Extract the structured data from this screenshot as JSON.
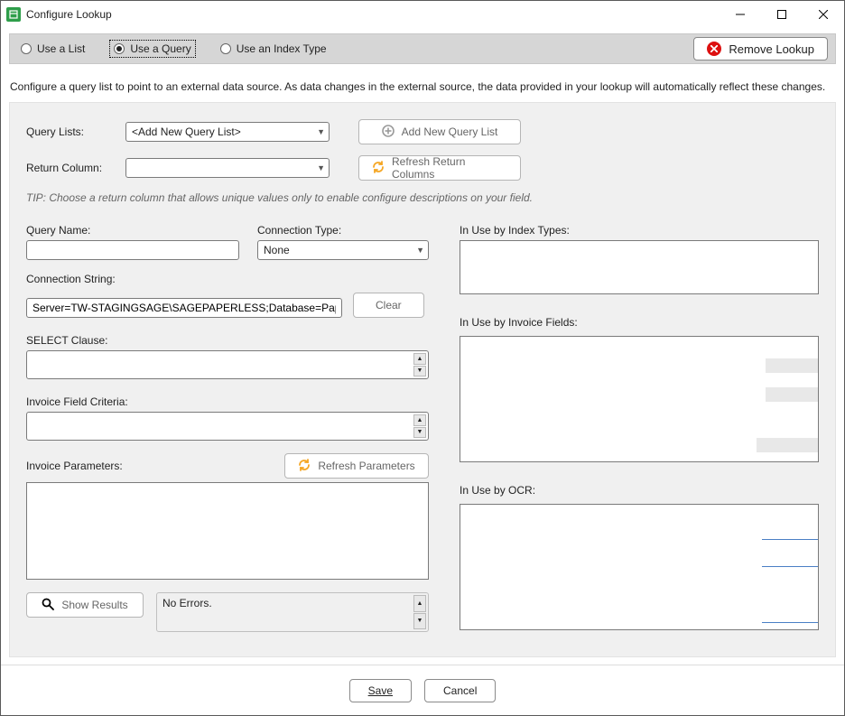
{
  "window": {
    "title": "Configure Lookup"
  },
  "modes": {
    "useList": "Use a List",
    "useQuery": "Use a Query",
    "useIndex": "Use an Index Type"
  },
  "removeLookup": "Remove Lookup",
  "description": "Configure a query list to point to an external data source. As data changes in the external source, the data provided in your lookup will automatically reflect these changes.",
  "labels": {
    "queryLists": "Query Lists:",
    "returnColumn": "Return Column:",
    "addNewQueryList": "Add New Query List",
    "refreshReturnColumns": "Refresh Return Columns",
    "queryName": "Query Name:",
    "connectionType": "Connection Type:",
    "connectionString": "Connection String:",
    "clear": "Clear",
    "selectClause": "SELECT Clause:",
    "invoiceFieldCriteria": "Invoice Field Criteria:",
    "invoiceParameters": "Invoice Parameters:",
    "refreshParameters": "Refresh Parameters",
    "showResults": "Show Results",
    "inUseIndex": "In Use by Index Types:",
    "inUseInvoice": "In Use by Invoice Fields:",
    "inUseOCR": "In Use by OCR:"
  },
  "tip": "TIP: Choose a return column that allows unique values only to enable configure descriptions on your field.",
  "values": {
    "queryListSelected": "<Add New Query List>",
    "returnColumnSelected": "",
    "queryName": "",
    "connectionType": "None",
    "connectionString": "Server=TW-STAGINGSAGE\\SAGEPAPERLESS;Database=PaperlessEr",
    "selectClause": "",
    "invoiceFieldCriteria": "",
    "errors": "No Errors."
  },
  "footer": {
    "save": "Save",
    "cancel": "Cancel"
  }
}
